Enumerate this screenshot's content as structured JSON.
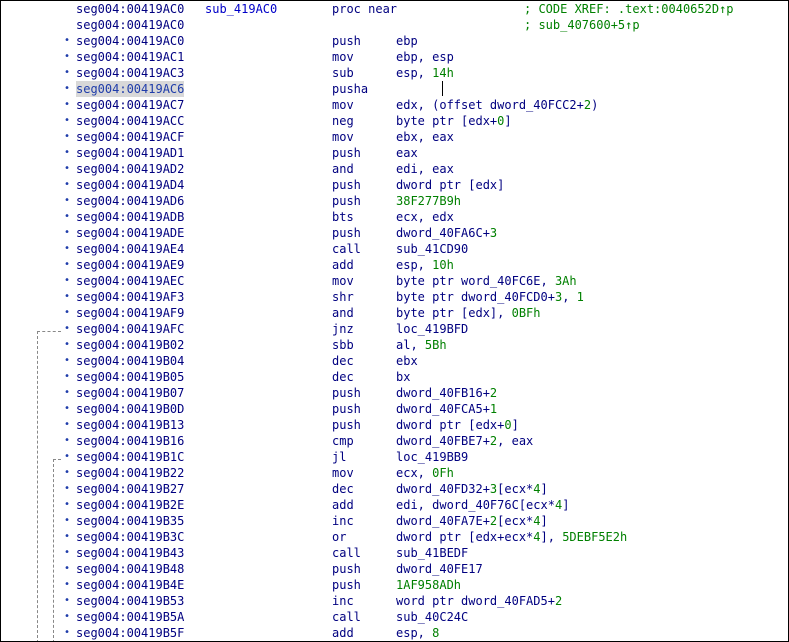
{
  "header": {
    "address": "seg004:00419AC0",
    "label": "sub_419AC0",
    "directive": "proc near",
    "xref1": "; CODE XREF: .text:0040652D↑p",
    "xref_address2": "seg004:00419AC0",
    "xref2": "; sub_407600+5↑p"
  },
  "rows": [
    {
      "addr": "seg004:00419AC0",
      "mnem": "push",
      "ops": [
        {
          "t": "ebp",
          "c": "name"
        }
      ]
    },
    {
      "addr": "seg004:00419AC1",
      "mnem": "mov",
      "ops": [
        {
          "t": "ebp, esp",
          "c": "name"
        }
      ]
    },
    {
      "addr": "seg004:00419AC3",
      "mnem": "sub",
      "ops": [
        {
          "t": "esp, ",
          "c": "name"
        },
        {
          "t": "14h",
          "c": "num"
        }
      ]
    },
    {
      "addr": "seg004:00419AC6",
      "mnem": "pusha",
      "ops": [],
      "current": true
    },
    {
      "addr": "seg004:00419AC7",
      "mnem": "mov",
      "ops": [
        {
          "t": "edx, (offset dword_40FCC2+",
          "c": "name"
        },
        {
          "t": "2",
          "c": "num"
        },
        {
          "t": ")",
          "c": "name"
        }
      ]
    },
    {
      "addr": "seg004:00419ACC",
      "mnem": "neg",
      "ops": [
        {
          "t": "byte ptr [edx+",
          "c": "name"
        },
        {
          "t": "0",
          "c": "num"
        },
        {
          "t": "]",
          "c": "name"
        }
      ]
    },
    {
      "addr": "seg004:00419ACF",
      "mnem": "mov",
      "ops": [
        {
          "t": "ebx, eax",
          "c": "name"
        }
      ]
    },
    {
      "addr": "seg004:00419AD1",
      "mnem": "push",
      "ops": [
        {
          "t": "eax",
          "c": "name"
        }
      ]
    },
    {
      "addr": "seg004:00419AD2",
      "mnem": "and",
      "ops": [
        {
          "t": "edi, eax",
          "c": "name"
        }
      ]
    },
    {
      "addr": "seg004:00419AD4",
      "mnem": "push",
      "ops": [
        {
          "t": "dword ptr [edx]",
          "c": "name"
        }
      ]
    },
    {
      "addr": "seg004:00419AD6",
      "mnem": "push",
      "ops": [
        {
          "t": "38F277B9h",
          "c": "num"
        }
      ]
    },
    {
      "addr": "seg004:00419ADB",
      "mnem": "bts",
      "ops": [
        {
          "t": "ecx, edx",
          "c": "name"
        }
      ]
    },
    {
      "addr": "seg004:00419ADE",
      "mnem": "push",
      "ops": [
        {
          "t": "dword_40FA6C+",
          "c": "name"
        },
        {
          "t": "3",
          "c": "num"
        }
      ]
    },
    {
      "addr": "seg004:00419AE4",
      "mnem": "call",
      "ops": [
        {
          "t": "sub_41CD90",
          "c": "name"
        }
      ]
    },
    {
      "addr": "seg004:00419AE9",
      "mnem": "add",
      "ops": [
        {
          "t": "esp, ",
          "c": "name"
        },
        {
          "t": "10h",
          "c": "num"
        }
      ]
    },
    {
      "addr": "seg004:00419AEC",
      "mnem": "mov",
      "ops": [
        {
          "t": "byte ptr word_40FC6E, ",
          "c": "name"
        },
        {
          "t": "3Ah",
          "c": "num"
        }
      ]
    },
    {
      "addr": "seg004:00419AF3",
      "mnem": "shr",
      "ops": [
        {
          "t": "byte ptr dword_40FCD0+",
          "c": "name"
        },
        {
          "t": "3",
          "c": "num"
        },
        {
          "t": ", ",
          "c": "name"
        },
        {
          "t": "1",
          "c": "num"
        }
      ]
    },
    {
      "addr": "seg004:00419AF9",
      "mnem": "and",
      "ops": [
        {
          "t": "byte ptr [edx], ",
          "c": "name"
        },
        {
          "t": "0BFh",
          "c": "num"
        }
      ]
    },
    {
      "addr": "seg004:00419AFC",
      "mnem": "jnz",
      "ops": [
        {
          "t": "loc_419BFD",
          "c": "name"
        }
      ]
    },
    {
      "addr": "seg004:00419B02",
      "mnem": "sbb",
      "ops": [
        {
          "t": "al, ",
          "c": "name"
        },
        {
          "t": "5Bh",
          "c": "num"
        }
      ]
    },
    {
      "addr": "seg004:00419B04",
      "mnem": "dec",
      "ops": [
        {
          "t": "ebx",
          "c": "name"
        }
      ]
    },
    {
      "addr": "seg004:00419B05",
      "mnem": "dec",
      "ops": [
        {
          "t": "bx",
          "c": "name"
        }
      ]
    },
    {
      "addr": "seg004:00419B07",
      "mnem": "push",
      "ops": [
        {
          "t": "dword_40FB16+",
          "c": "name"
        },
        {
          "t": "2",
          "c": "num"
        }
      ]
    },
    {
      "addr": "seg004:00419B0D",
      "mnem": "push",
      "ops": [
        {
          "t": "dword_40FCA5+",
          "c": "name"
        },
        {
          "t": "1",
          "c": "num"
        }
      ]
    },
    {
      "addr": "seg004:00419B13",
      "mnem": "push",
      "ops": [
        {
          "t": "dword ptr [edx+",
          "c": "name"
        },
        {
          "t": "0",
          "c": "num"
        },
        {
          "t": "]",
          "c": "name"
        }
      ]
    },
    {
      "addr": "seg004:00419B16",
      "mnem": "cmp",
      "ops": [
        {
          "t": "dword_40FBE7+",
          "c": "name"
        },
        {
          "t": "2",
          "c": "num"
        },
        {
          "t": ", eax",
          "c": "name"
        }
      ]
    },
    {
      "addr": "seg004:00419B1C",
      "mnem": "jl",
      "ops": [
        {
          "t": "loc_419BB9",
          "c": "name"
        }
      ]
    },
    {
      "addr": "seg004:00419B22",
      "mnem": "mov",
      "ops": [
        {
          "t": "ecx, ",
          "c": "name"
        },
        {
          "t": "0Fh",
          "c": "num"
        }
      ]
    },
    {
      "addr": "seg004:00419B27",
      "mnem": "dec",
      "ops": [
        {
          "t": "dword_40FD32+",
          "c": "name"
        },
        {
          "t": "3",
          "c": "num"
        },
        {
          "t": "[ecx*",
          "c": "name"
        },
        {
          "t": "4",
          "c": "num"
        },
        {
          "t": "]",
          "c": "name"
        }
      ]
    },
    {
      "addr": "seg004:00419B2E",
      "mnem": "add",
      "ops": [
        {
          "t": "edi, dword_40F76C[ecx*",
          "c": "name"
        },
        {
          "t": "4",
          "c": "num"
        },
        {
          "t": "]",
          "c": "name"
        }
      ]
    },
    {
      "addr": "seg004:00419B35",
      "mnem": "inc",
      "ops": [
        {
          "t": "dword_40FA7E+",
          "c": "name"
        },
        {
          "t": "2",
          "c": "num"
        },
        {
          "t": "[ecx*",
          "c": "name"
        },
        {
          "t": "4",
          "c": "num"
        },
        {
          "t": "]",
          "c": "name"
        }
      ]
    },
    {
      "addr": "seg004:00419B3C",
      "mnem": "or",
      "ops": [
        {
          "t": "dword ptr [edx+ecx*",
          "c": "name"
        },
        {
          "t": "4",
          "c": "num"
        },
        {
          "t": "], ",
          "c": "name"
        },
        {
          "t": "5DEBF5E2h",
          "c": "num"
        }
      ]
    },
    {
      "addr": "seg004:00419B43",
      "mnem": "call",
      "ops": [
        {
          "t": "sub_41BEDF",
          "c": "name"
        }
      ]
    },
    {
      "addr": "seg004:00419B48",
      "mnem": "push",
      "ops": [
        {
          "t": "dword_40FE17",
          "c": "name"
        }
      ]
    },
    {
      "addr": "seg004:00419B4E",
      "mnem": "push",
      "ops": [
        {
          "t": "1AF958ADh",
          "c": "num"
        }
      ]
    },
    {
      "addr": "seg004:00419B53",
      "mnem": "inc",
      "ops": [
        {
          "t": "word ptr dword_40FAD5+",
          "c": "name"
        },
        {
          "t": "2",
          "c": "num"
        }
      ]
    },
    {
      "addr": "seg004:00419B5A",
      "mnem": "call",
      "ops": [
        {
          "t": "sub_40C24C",
          "c": "name"
        }
      ]
    },
    {
      "addr": "seg004:00419B5F",
      "mnem": "add",
      "ops": [
        {
          "t": "esp, ",
          "c": "name"
        },
        {
          "t": "8",
          "c": "num"
        }
      ]
    }
  ],
  "colors": {
    "address": "#000080",
    "label": "#0000c8",
    "comment": "#008000",
    "immediate": "#008000"
  }
}
